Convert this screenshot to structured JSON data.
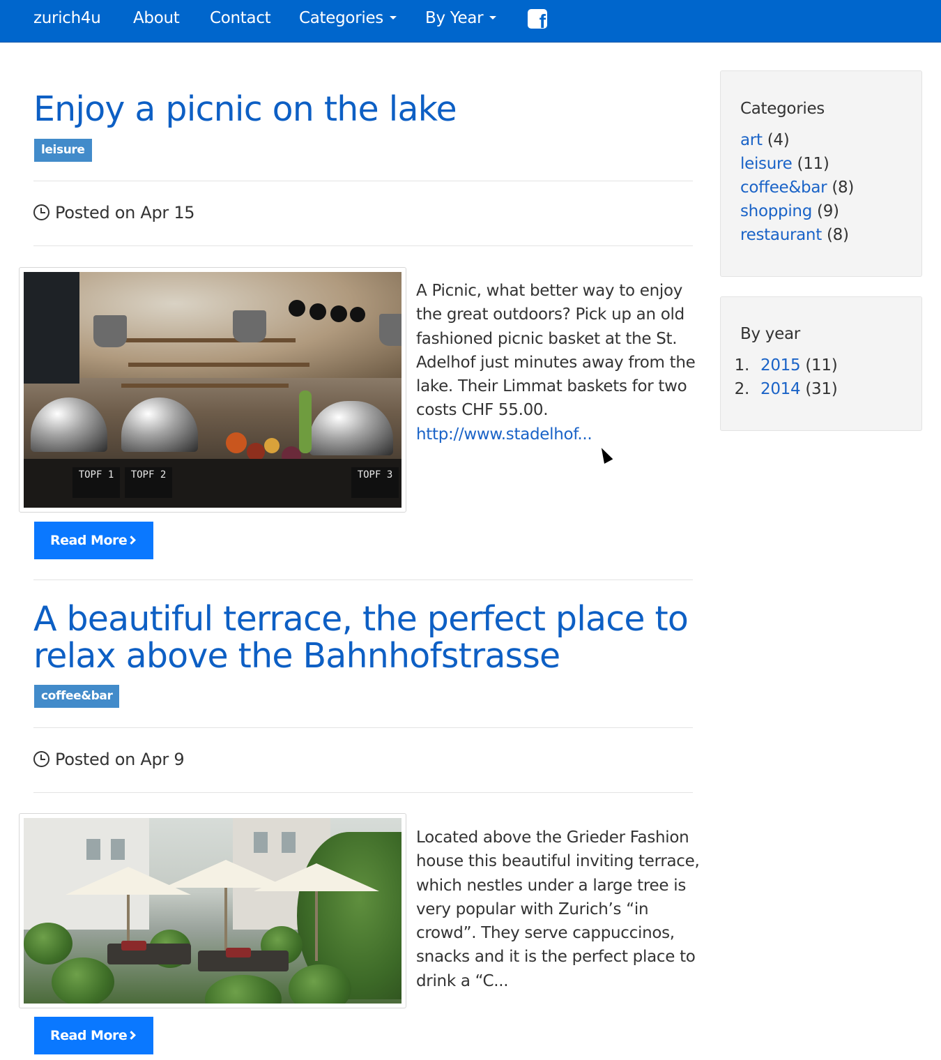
{
  "navbar": {
    "brand": "zurich4u",
    "about": "About",
    "contact": "Contact",
    "categories": "Categories",
    "by_year": "By Year",
    "facebook_glyph": "f",
    "color": "#0066cc"
  },
  "posts": [
    {
      "title": "Enjoy a picnic on the lake",
      "tag": "leisure",
      "posted": "Posted on Apr 15",
      "excerpt": "A Picnic, what better way to enjoy the great outdoors? Pick up an old fashioned picnic basket at the St. Adelhof just minutes away from the lake. Their Limmat baskets for two costs CHF 55.00.",
      "link": "http://www.stadelhof...",
      "read_more": "Read More",
      "image_signs": [
        "TOPF 1",
        "TOPF 2",
        "TOPF 3"
      ]
    },
    {
      "title": "A beautiful terrace, the perfect place to relax above the Bahnhofstrasse",
      "tag": "coffee&bar",
      "posted": "Posted on Apr 9",
      "excerpt": "Located above the Grieder Fashion house this beautiful inviting terrace, which nestles under a large tree is very popular with Zurich’s  “in crowd”. They serve cappuccinos, snacks and it is the perfect place to drink a “C...",
      "read_more": "Read More"
    }
  ],
  "sidebar": {
    "categories": {
      "title": "Categories",
      "items": [
        {
          "name": "art",
          "count": "(4)"
        },
        {
          "name": "leisure",
          "count": "(11)"
        },
        {
          "name": "coffee&bar",
          "count": "(8)"
        },
        {
          "name": "shopping",
          "count": "(9)"
        },
        {
          "name": "restaurant",
          "count": "(8)"
        }
      ]
    },
    "by_year": {
      "title": "By year",
      "items": [
        {
          "num": "1.",
          "year": "2015",
          "count": "(11)"
        },
        {
          "num": "2.",
          "year": "2014",
          "count": "(31)"
        }
      ]
    }
  },
  "colors": {
    "link": "#1a63c7",
    "title": "#0d5fc4",
    "tag_bg": "#428bca",
    "button_bg": "#0a78ff"
  }
}
